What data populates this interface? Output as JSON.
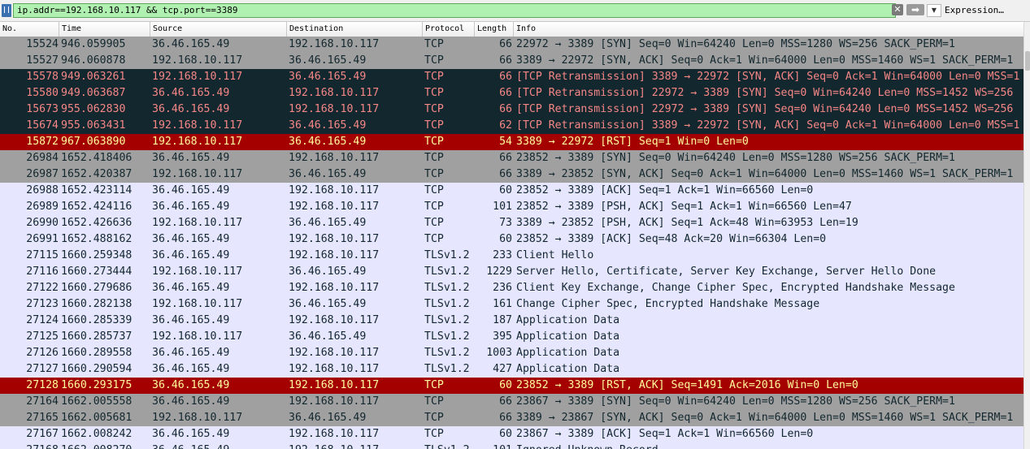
{
  "filter": {
    "value": "ip.addr==192.168.10.117 && tcp.port==3389",
    "clear_icon": "✕",
    "apply_icon": "➡",
    "dropdown_icon": "▼",
    "expression_label": "Expression…"
  },
  "columns": [
    "No.",
    "Time",
    "Source",
    "Destination",
    "Protocol",
    "Length",
    "Info"
  ],
  "colors": {
    "gray_row": "#a0a0a0",
    "dark_row": "#12272e",
    "red_row": "#a40000",
    "light_row": "#e7e6ff",
    "filter_ok": "#b0f0b0"
  },
  "packets": [
    {
      "no": "15524",
      "time": "946.059905",
      "src": "36.46.165.49",
      "dst": "192.168.10.117",
      "proto": "TCP",
      "len": "66",
      "info": "22972 → 3389 [SYN] Seq=0 Win=64240 Len=0 MSS=1280 WS=256 SACK_PERM=1",
      "style": "gray"
    },
    {
      "no": "15527",
      "time": "946.060878",
      "src": "192.168.10.117",
      "dst": "36.46.165.49",
      "proto": "TCP",
      "len": "66",
      "info": "3389 → 22972 [SYN, ACK] Seq=0 Ack=1 Win=64000 Len=0 MSS=1460 WS=1 SACK_PERM=1",
      "style": "gray"
    },
    {
      "no": "15578",
      "time": "949.063261",
      "src": "192.168.10.117",
      "dst": "36.46.165.49",
      "proto": "TCP",
      "len": "66",
      "info": "[TCP Retransmission] 3389 → 22972 [SYN, ACK] Seq=0 Ack=1 Win=64000 Len=0 MSS=1",
      "style": "dark"
    },
    {
      "no": "15580",
      "time": "949.063687",
      "src": "36.46.165.49",
      "dst": "192.168.10.117",
      "proto": "TCP",
      "len": "66",
      "info": "[TCP Retransmission] 22972 → 3389 [SYN] Seq=0 Win=64240 Len=0 MSS=1452 WS=256",
      "style": "dark"
    },
    {
      "no": "15673",
      "time": "955.062830",
      "src": "36.46.165.49",
      "dst": "192.168.10.117",
      "proto": "TCP",
      "len": "66",
      "info": "[TCP Retransmission] 22972 → 3389 [SYN] Seq=0 Win=64240 Len=0 MSS=1452 WS=256",
      "style": "dark"
    },
    {
      "no": "15674",
      "time": "955.063431",
      "src": "192.168.10.117",
      "dst": "36.46.165.49",
      "proto": "TCP",
      "len": "62",
      "info": "[TCP Retransmission] 3389 → 22972 [SYN, ACK] Seq=0 Ack=1 Win=64000 Len=0 MSS=1",
      "style": "dark"
    },
    {
      "no": "15872",
      "time": "967.063890",
      "src": "192.168.10.117",
      "dst": "36.46.165.49",
      "proto": "TCP",
      "len": "54",
      "info": "3389 → 22972 [RST] Seq=1 Win=0 Len=0",
      "style": "red"
    },
    {
      "no": "26984",
      "time": "1652.418406",
      "src": "36.46.165.49",
      "dst": "192.168.10.117",
      "proto": "TCP",
      "len": "66",
      "info": "23852 → 3389 [SYN] Seq=0 Win=64240 Len=0 MSS=1280 WS=256 SACK_PERM=1",
      "style": "gray"
    },
    {
      "no": "26987",
      "time": "1652.420387",
      "src": "192.168.10.117",
      "dst": "36.46.165.49",
      "proto": "TCP",
      "len": "66",
      "info": "3389 → 23852 [SYN, ACK] Seq=0 Ack=1 Win=64000 Len=0 MSS=1460 WS=1 SACK_PERM=1",
      "style": "gray"
    },
    {
      "no": "26988",
      "time": "1652.423114",
      "src": "36.46.165.49",
      "dst": "192.168.10.117",
      "proto": "TCP",
      "len": "60",
      "info": "23852 → 3389 [ACK] Seq=1 Ack=1 Win=66560 Len=0",
      "style": "light sel"
    },
    {
      "no": "26989",
      "time": "1652.424116",
      "src": "36.46.165.49",
      "dst": "192.168.10.117",
      "proto": "TCP",
      "len": "101",
      "info": "23852 → 3389 [PSH, ACK] Seq=1 Ack=1 Win=66560 Len=47",
      "style": "light"
    },
    {
      "no": "26990",
      "time": "1652.426636",
      "src": "192.168.10.117",
      "dst": "36.46.165.49",
      "proto": "TCP",
      "len": "73",
      "info": "3389 → 23852 [PSH, ACK] Seq=1 Ack=48 Win=63953 Len=19",
      "style": "light"
    },
    {
      "no": "26991",
      "time": "1652.488162",
      "src": "36.46.165.49",
      "dst": "192.168.10.117",
      "proto": "TCP",
      "len": "60",
      "info": "23852 → 3389 [ACK] Seq=48 Ack=20 Win=66304 Len=0",
      "style": "light"
    },
    {
      "no": "27115",
      "time": "1660.259348",
      "src": "36.46.165.49",
      "dst": "192.168.10.117",
      "proto": "TLSv1.2",
      "len": "233",
      "info": "Client Hello",
      "style": "light"
    },
    {
      "no": "27116",
      "time": "1660.273444",
      "src": "192.168.10.117",
      "dst": "36.46.165.49",
      "proto": "TLSv1.2",
      "len": "1229",
      "info": "Server Hello, Certificate, Server Key Exchange, Server Hello Done",
      "style": "light"
    },
    {
      "no": "27122",
      "time": "1660.279686",
      "src": "36.46.165.49",
      "dst": "192.168.10.117",
      "proto": "TLSv1.2",
      "len": "236",
      "info": "Client Key Exchange, Change Cipher Spec, Encrypted Handshake Message",
      "style": "light"
    },
    {
      "no": "27123",
      "time": "1660.282138",
      "src": "192.168.10.117",
      "dst": "36.46.165.49",
      "proto": "TLSv1.2",
      "len": "161",
      "info": "Change Cipher Spec, Encrypted Handshake Message",
      "style": "light"
    },
    {
      "no": "27124",
      "time": "1660.285339",
      "src": "36.46.165.49",
      "dst": "192.168.10.117",
      "proto": "TLSv1.2",
      "len": "187",
      "info": "Application Data",
      "style": "light"
    },
    {
      "no": "27125",
      "time": "1660.285737",
      "src": "192.168.10.117",
      "dst": "36.46.165.49",
      "proto": "TLSv1.2",
      "len": "395",
      "info": "Application Data",
      "style": "light"
    },
    {
      "no": "27126",
      "time": "1660.289558",
      "src": "36.46.165.49",
      "dst": "192.168.10.117",
      "proto": "TLSv1.2",
      "len": "1003",
      "info": "Application Data",
      "style": "light"
    },
    {
      "no": "27127",
      "time": "1660.290594",
      "src": "36.46.165.49",
      "dst": "192.168.10.117",
      "proto": "TLSv1.2",
      "len": "427",
      "info": "Application Data",
      "style": "light"
    },
    {
      "no": "27128",
      "time": "1660.293175",
      "src": "36.46.165.49",
      "dst": "192.168.10.117",
      "proto": "TCP",
      "len": "60",
      "info": "23852 → 3389 [RST, ACK] Seq=1491 Ack=2016 Win=0 Len=0",
      "style": "red"
    },
    {
      "no": "27164",
      "time": "1662.005558",
      "src": "36.46.165.49",
      "dst": "192.168.10.117",
      "proto": "TCP",
      "len": "66",
      "info": "23867 → 3389 [SYN] Seq=0 Win=64240 Len=0 MSS=1280 WS=256 SACK_PERM=1",
      "style": "gray"
    },
    {
      "no": "27165",
      "time": "1662.005681",
      "src": "192.168.10.117",
      "dst": "36.46.165.49",
      "proto": "TCP",
      "len": "66",
      "info": "3389 → 23867 [SYN, ACK] Seq=0 Ack=1 Win=64000 Len=0 MSS=1460 WS=1 SACK_PERM=1",
      "style": "gray"
    },
    {
      "no": "27167",
      "time": "1662.008242",
      "src": "36.46.165.49",
      "dst": "192.168.10.117",
      "proto": "TCP",
      "len": "60",
      "info": "23867 → 3389 [ACK] Seq=1 Ack=1 Win=66560 Len=0",
      "style": "light"
    },
    {
      "no": "27168",
      "time": "1662.008270",
      "src": "36.46.165.49",
      "dst": "192.168.10.117",
      "proto": "TLSv1.2",
      "len": "101",
      "info": "Ignored Unknown Record",
      "style": "light"
    }
  ]
}
